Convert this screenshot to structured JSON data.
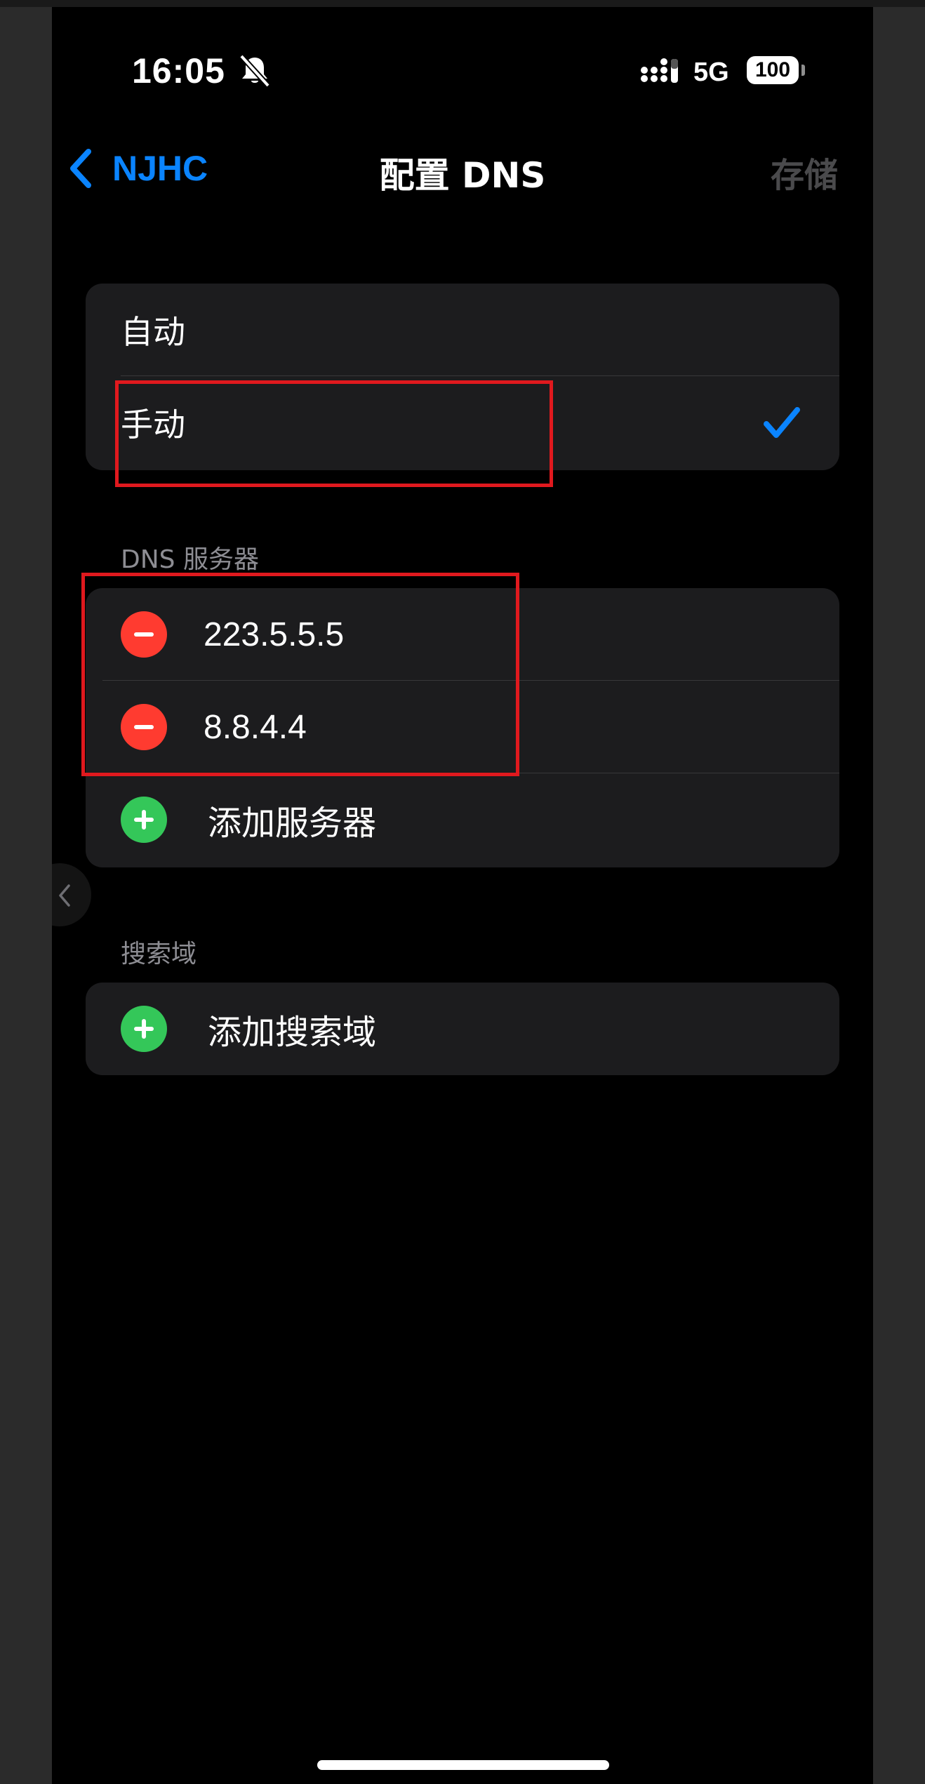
{
  "status_bar": {
    "time": "16:05",
    "network": "5G",
    "battery": "100"
  },
  "nav": {
    "back_label": "NJHC",
    "title": "配置 DNS",
    "save_label": "存储"
  },
  "dns_mode": {
    "options": [
      {
        "label": "自动",
        "selected": false
      },
      {
        "label": "手动",
        "selected": true
      }
    ]
  },
  "dns_servers": {
    "header": "DNS 服务器",
    "servers": [
      "223.5.5.5",
      "8.8.4.4"
    ],
    "add_label": "添加服务器"
  },
  "search_domains": {
    "header": "搜索域",
    "add_label": "添加搜索域"
  },
  "colors": {
    "accent": "#0a84ff",
    "delete": "#ff3b30",
    "add": "#34c759",
    "annotation": "#e0191e"
  },
  "icons": [
    "chevron-left-icon",
    "bell-slash-icon",
    "signal-icon",
    "checkmark-icon",
    "minus-circle-icon",
    "plus-circle-icon"
  ]
}
